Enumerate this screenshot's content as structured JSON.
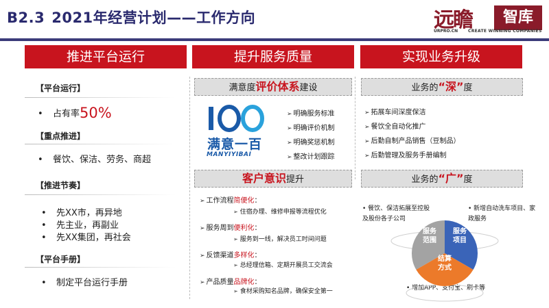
{
  "header": {
    "code": "B2.3",
    "title": "2021年经营计划——工作方向",
    "logo": {
      "calligraphy": "远瞻",
      "box": "智库",
      "sub1": "URPRO.CN",
      "sub2": "CREATE WINNING COMPANIES"
    }
  },
  "columns": {
    "c1": "推进平台运行",
    "c2": "提升服务质量",
    "c3": "实现业务升级"
  },
  "col1": {
    "label_platform": "【平台运行】",
    "item_share_prefix": "占有率",
    "item_share_value": "50%",
    "label_focus": "【重点推进】",
    "item_focus": "餐饮、保洁、劳务、商超",
    "label_rhythm": "【推进节奏】",
    "rhythm": [
      "先XX市，再异地",
      "先主业，再副业",
      "先XX集团，再社会"
    ],
    "label_manual": "【平台手册】",
    "item_manual": "制定平台运行手册",
    "bullet": "•"
  },
  "col2": {
    "bar1_pre": "满意度",
    "bar1_hl": "评价体系",
    "bar1_post": "建设",
    "logo_number": "100",
    "logo_text": "满意一百",
    "logo_sub": "MANYIYIBAI",
    "arrow": "➢",
    "list": [
      "明确服务标准",
      "明确评价机制",
      "明确奖惩机制",
      "整改计划跟踪"
    ],
    "bar2_hl": "客户意识",
    "bar2_post": "提升",
    "sections": [
      {
        "pre": "工作流程",
        "red": "简便化",
        "post": "：",
        "sub": "住宿办理、维修申报等流程优化"
      },
      {
        "pre": "服务周到",
        "red": "便利化",
        "post": "：",
        "sub": "服务到一线，解决员工时间问题"
      },
      {
        "pre": "反馈渠道",
        "red": "多样化",
        "post": "：",
        "sub": "总经理信箱、定期开展员工交流会"
      },
      {
        "pre": "产品质量",
        "red": "品牌化",
        "post": "：",
        "sub": "食材采购知名品牌，确保安全第一"
      }
    ]
  },
  "col3": {
    "bar1_pre": "业务的",
    "bar1_q": "“深”",
    "bar1_post": "度",
    "list": [
      "拓展车间深度保洁",
      "餐饮全自动化推广",
      "后勤自制产品销售（豆制品）",
      "后勤管理及服务手册编制"
    ],
    "bar2_pre": "业务的",
    "bar2_q": "“广”",
    "bar2_post": "度",
    "left_note": "• 餐饮、保洁拓展至控股及股份各子公司",
    "right_note": "• 新增自动洗车项目、家政服务",
    "bottom_note": "• 增加APP、支付宝、刷卡等",
    "pie": {
      "left": "服务\n范围",
      "right": "服务\n项目",
      "bottom": "结算\n方式",
      "colors": {
        "left": "#a3a3a3",
        "right": "#3a64b8",
        "bottom": "#ec7a2a"
      }
    }
  }
}
